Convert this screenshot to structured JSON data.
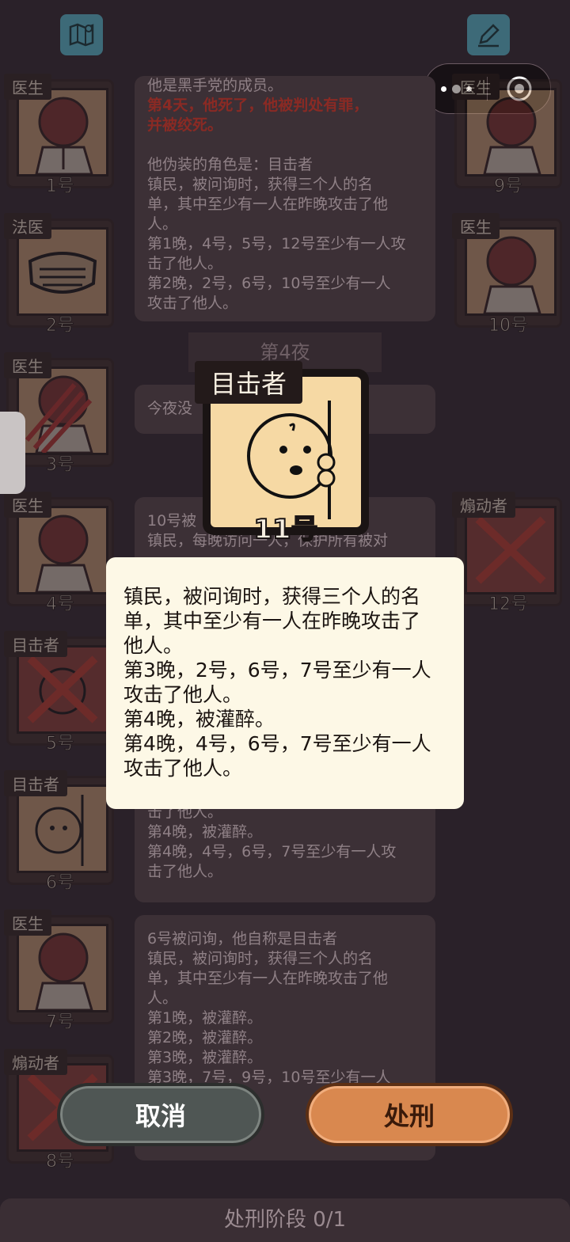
{
  "players": [
    {
      "number": "1号",
      "role": "医生",
      "icon": "doctor-figure-icon",
      "state": "alive"
    },
    {
      "number": "2号",
      "role": "法医",
      "icon": "face-mask-icon",
      "state": "alive"
    },
    {
      "number": "3号",
      "role": "医生",
      "icon": "doctor-figure-icon",
      "state": "attacked"
    },
    {
      "number": "4号",
      "role": "医生",
      "icon": "doctor-figure-icon",
      "state": "alive"
    },
    {
      "number": "5号",
      "role": "目击者",
      "icon": "peeking-face-icon",
      "state": "dead"
    },
    {
      "number": "6号",
      "role": "目击者",
      "icon": "peeking-face-icon",
      "state": "alive"
    },
    {
      "number": "7号",
      "role": "医生",
      "icon": "doctor-figure-icon",
      "state": "alive"
    },
    {
      "number": "8号",
      "role": "煽动者",
      "icon": "instigator-icon",
      "state": "dead"
    },
    {
      "number": "9号",
      "role": "医生",
      "icon": "doctor-figure-icon",
      "state": "alive"
    },
    {
      "number": "10号",
      "role": "医生",
      "icon": "doctor-figure-icon",
      "state": "alive"
    },
    {
      "number": "12号",
      "role": "煽动者",
      "icon": "instigator-icon",
      "state": "dead"
    }
  ],
  "log_top": {
    "line1": "他是黑手党的成员。",
    "death1": "第4天，他死了，他被判处有罪，",
    "death2": "并被绞死。",
    "l3": "他伪装的角色是：目击者",
    "l4": "镇民，被问询时，获得三个人的名",
    "l5": "单，其中至少有一人在昨晚攻击了他",
    "l6": "人。",
    "l7": "第1晚，4号，5号，12号至少有一人攻",
    "l8": "击了他人。",
    "l9": "第2晚，2号，6号，10号至少有一人",
    "l10": "攻击了他人。"
  },
  "night_label": "第4夜",
  "night_text": "今夜没",
  "log_mid": {
    "l1": "10号被",
    "l2": "镇民，每晚访问一人，保护所有被对",
    "l3": "击了他人。",
    "l4": "第4晚，被灌醉。",
    "l5": "第4晚，4号，6号，7号至少有一人攻",
    "l6": "击了他人。"
  },
  "log_bottom": {
    "l1": "6号被问询，他自称是目击者",
    "l2": "镇民，被问询时，获得三个人的名",
    "l3": "单，其中至少有一人在昨晚攻击了他",
    "l4": "人。",
    "l5": "第1晚，被灌醉。",
    "l6": "第2晚，被灌醉。",
    "l7": "第3晚，被灌醉。",
    "l8": "第3晚，7号，9号，10号至少有一人"
  },
  "focus": {
    "role": "目击者",
    "number": "11号",
    "icon": "peeking-face-icon"
  },
  "popup": {
    "line1": "镇民，被问询时，获得三个人的名",
    "line2": "单，其中至少有一人在昨晚攻击了",
    "line3": "他人。",
    "line4": "第3晚，2号，6号，7号至少有一人",
    "line5": "攻击了他人。",
    "line6": "第4晚，被灌醉。",
    "line7": "第4晚，4号，6号，7号至少有一人",
    "line8": "攻击了他人。"
  },
  "buttons": {
    "cancel": "取消",
    "execute": "处刑"
  },
  "phase": "处刑阶段 0/1",
  "colors": {
    "accent_orange": "#d9884f",
    "cancel_gray": "#4f5654",
    "popup_bg": "#fdf8e6",
    "card_bg": "#c49a70"
  }
}
